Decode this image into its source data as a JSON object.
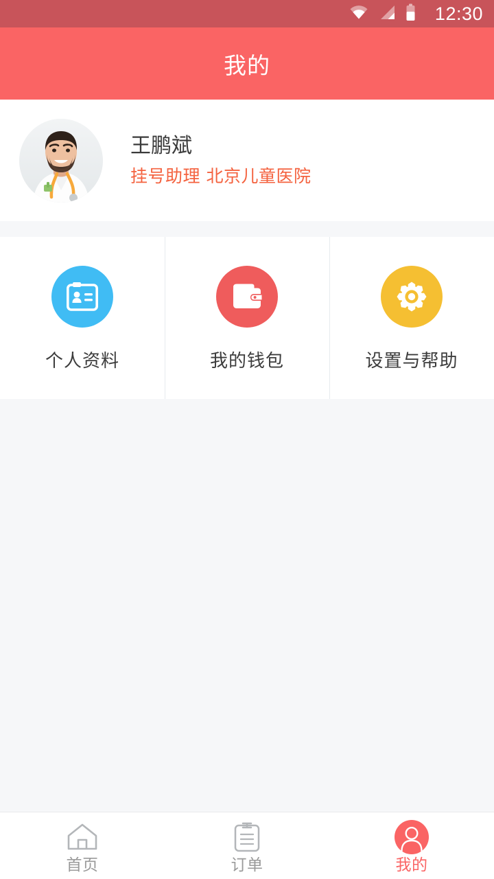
{
  "theme": {
    "status_bar_bg": "#c8545a",
    "header_bg": "#fa6464",
    "page_bg": "#f6f7f9",
    "card_bg": "#ffffff",
    "accent": "#fa6464",
    "role_text": "#f4623f",
    "inactive_nav": "#9a9a9a"
  },
  "status_bar": {
    "time": "12:30",
    "icons": [
      "wifi-icon",
      "cellular-signal-icon",
      "battery-icon"
    ]
  },
  "header": {
    "title": "我的"
  },
  "profile": {
    "avatar": "doctor-photo-avatar",
    "name": "王鹏斌",
    "role": "挂号助理",
    "hospital": "北京儿童医院",
    "role_line": "挂号助理  北京儿童医院"
  },
  "shortcuts": [
    {
      "label": "个人资料",
      "icon": "id-card-icon",
      "color": "#40bcf4",
      "name": "shortcut-personal-profile"
    },
    {
      "label": "我的钱包",
      "icon": "wallet-icon",
      "color": "#ef5c5c",
      "name": "shortcut-my-wallet"
    },
    {
      "label": "设置与帮助",
      "icon": "gear-icon",
      "color": "#f5bf32",
      "name": "shortcut-settings-help"
    }
  ],
  "bottom_nav": {
    "items": [
      {
        "label": "首页",
        "icon": "home-icon",
        "active": false,
        "name": "nav-home"
      },
      {
        "label": "订单",
        "icon": "clipboard-order-icon",
        "active": false,
        "name": "nav-orders"
      },
      {
        "label": "我的",
        "icon": "person-icon",
        "active": true,
        "name": "nav-profile"
      }
    ]
  }
}
